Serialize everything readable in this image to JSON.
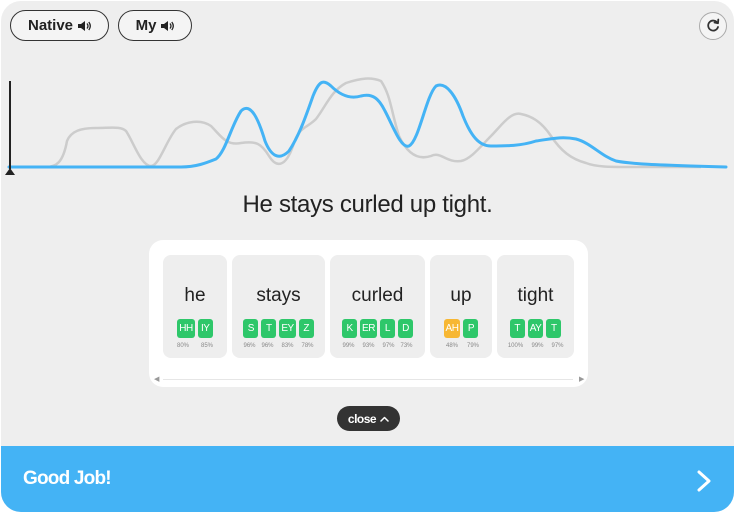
{
  "controls": {
    "native_label": "Native",
    "my_label": "My",
    "speaker_icon": "speaker-icon",
    "refresh_icon": "refresh-icon"
  },
  "waveform": {
    "native_color": "#cccccc",
    "user_color": "#44b3f5"
  },
  "sentence": "He stays curled up tight.",
  "words": [
    {
      "text": "he",
      "phonemes": [
        {
          "label": "HH",
          "score": "80%",
          "status": "good"
        },
        {
          "label": "IY",
          "score": "85%",
          "status": "good"
        }
      ]
    },
    {
      "text": "stays",
      "phonemes": [
        {
          "label": "S",
          "score": "96%",
          "status": "good"
        },
        {
          "label": "T",
          "score": "96%",
          "status": "good"
        },
        {
          "label": "EY",
          "score": "83%",
          "status": "good"
        },
        {
          "label": "Z",
          "score": "78%",
          "status": "good"
        }
      ]
    },
    {
      "text": "curled",
      "phonemes": [
        {
          "label": "K",
          "score": "99%",
          "status": "good"
        },
        {
          "label": "ER",
          "score": "93%",
          "status": "good"
        },
        {
          "label": "L",
          "score": "97%",
          "status": "good"
        },
        {
          "label": "D",
          "score": "73%",
          "status": "good"
        }
      ]
    },
    {
      "text": "up",
      "phonemes": [
        {
          "label": "AH",
          "score": "48%",
          "status": "warn"
        },
        {
          "label": "P",
          "score": "79%",
          "status": "good"
        }
      ]
    },
    {
      "text": "tight",
      "phonemes": [
        {
          "label": "T",
          "score": "100%",
          "status": "good"
        },
        {
          "label": "AY",
          "score": "99%",
          "status": "good"
        },
        {
          "label": "T",
          "score": "97%",
          "status": "good"
        }
      ]
    }
  ],
  "close_label": "close",
  "footer": {
    "title": "Good Job!",
    "next_icon": "chevron-right-icon"
  },
  "colors": {
    "good": "#2ec76a",
    "warn": "#f7b733",
    "accent": "#44b3f5"
  }
}
